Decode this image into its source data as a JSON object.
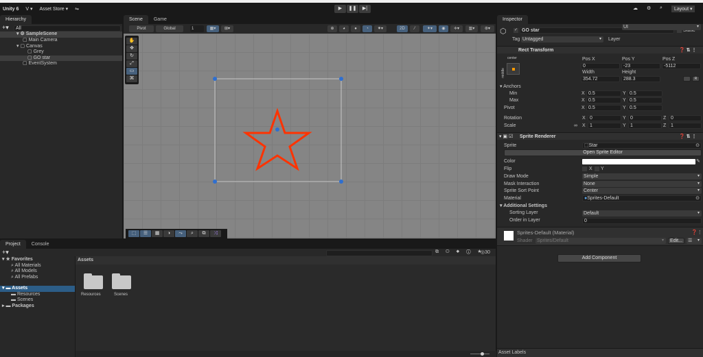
{
  "topbar": {
    "app": "Unity 6",
    "account": "V ▾",
    "asset_store": "Asset Store ▾",
    "layout": "Layout ▾",
    "play": "▶",
    "pause": "❚❚",
    "step": "▶|"
  },
  "hierarchy": {
    "title": "Hierarchy",
    "search_placeholder": "All",
    "items": [
      {
        "label": "SampleScene"
      },
      {
        "label": "Main Camera"
      },
      {
        "label": "Canvas"
      },
      {
        "label": "Grey"
      },
      {
        "label": "GO star"
      },
      {
        "label": "EventSystem"
      }
    ]
  },
  "scene": {
    "tabs": [
      "Scene",
      "Game"
    ],
    "pivot": "Pivot",
    "global": "Global",
    "grid_value": "1",
    "mode_2d": "2D"
  },
  "inspector": {
    "title": "Inspector",
    "object_name": "GO star",
    "static_label": "Static",
    "tag_label": "Tag",
    "tag": "Untagged",
    "layer_label": "Layer",
    "layer": "UI",
    "rect_transform": {
      "title": "Rect Transform",
      "anchor_h": "center",
      "anchor_v": "middle",
      "pos_x_label": "Pos X",
      "pos_y_label": "Pos Y",
      "pos_z_label": "Pos Z",
      "pos_x": "0",
      "pos_y": "-23",
      "pos_z": "-5112",
      "width_label": "Width",
      "height_label": "Height",
      "width": "354.72",
      "height": "288.3",
      "r_label": "R",
      "anchors_label": "Anchors",
      "min_label": "Min",
      "max_label": "Max",
      "pivot_label": "Pivot",
      "x": "X",
      "y": "Y",
      "z": "Z",
      "min_x": "0.5",
      "min_y": "0.5",
      "max_x": "0.5",
      "max_y": "0.5",
      "pivot_x": "0.5",
      "pivot_y": "0.5",
      "rotation_label": "Rotation",
      "scale_label": "Scale",
      "rot_x": "0",
      "rot_y": "0",
      "rot_z": "0",
      "scale_x": "1",
      "scale_y": "1",
      "scale_z": "1"
    },
    "sprite_renderer": {
      "title": "Sprite Renderer",
      "sprite_label": "Sprite",
      "sprite": "Star",
      "open_editor": "Open Sprite Editor",
      "color_label": "Color",
      "color": "#ffffff",
      "flip_label": "Flip",
      "flip_x": "X",
      "flip_y": "Y",
      "draw_mode_label": "Draw Mode",
      "draw_mode": "Simple",
      "mask_label": "Mask Interaction",
      "mask": "None",
      "sort_point_label": "Sprite Sort Point",
      "sort_point": "Center",
      "material_label": "Material",
      "material": "Sprites-Default",
      "additional": "Additional Settings",
      "sorting_layer_label": "Sorting Layer",
      "sorting_layer": "Default",
      "order_label": "Order in Layer",
      "order": "0"
    },
    "material": {
      "title": "Sprites-Default (Material)",
      "shader_label": "Shader",
      "shader": "Sprites/Default",
      "edit": "Edit..."
    },
    "add_component": "Add Component",
    "asset_labels": "Asset Labels"
  },
  "project": {
    "tabs": [
      "Project",
      "Console"
    ],
    "favorites": "Favorites",
    "fav_items": [
      "All Materials",
      "All Models",
      "All Prefabs"
    ],
    "assets": "Assets",
    "asset_children": [
      "Resources",
      "Scenes"
    ],
    "packages": "Packages",
    "breadcrumb": "Assets",
    "folders": [
      "Resources",
      "Scenes"
    ],
    "count": "30"
  },
  "colors": {
    "accent": "#2c5d87",
    "star": "#ff3300",
    "handle": "#2f6fd0"
  }
}
